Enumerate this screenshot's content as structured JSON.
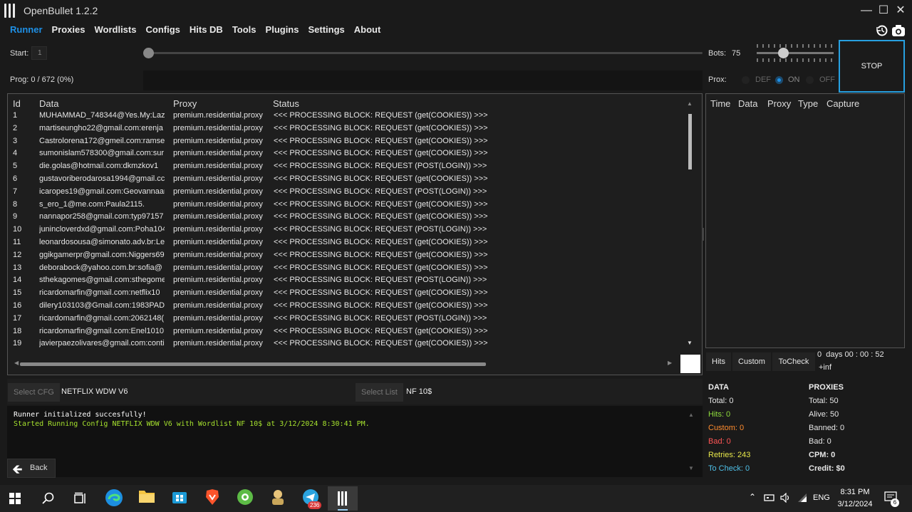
{
  "window": {
    "title": "OpenBullet 1.2.2"
  },
  "menu": [
    "Runner",
    "Proxies",
    "Wordlists",
    "Configs",
    "Hits DB",
    "Tools",
    "Plugins",
    "Settings",
    "About"
  ],
  "controls": {
    "start_label": "Start:",
    "start_value": "1",
    "prog_label": "Prog: 0 / 672 (0%)",
    "progress_fraction": 0,
    "bots_label": "Bots:",
    "bots_value": "75",
    "stop_label": "STOP",
    "prox_label": "Prox:",
    "prox_options": [
      "DEF",
      "ON",
      "OFF"
    ],
    "prox_selected": "ON"
  },
  "grid": {
    "columns": [
      "Id",
      "Data",
      "Proxy",
      "Status"
    ],
    "rows": [
      [
        "1",
        "MUHAMMAD_748344@Yes.My:Lazi",
        "premium.residential.proxy",
        "<<< PROCESSING BLOCK: REQUEST (get(COOKIES)) >>>"
      ],
      [
        "2",
        "martiseungho22@gmail.com:erenja",
        "premium.residential.proxy",
        "<<< PROCESSING BLOCK: REQUEST (get(COOKIES)) >>>"
      ],
      [
        "3",
        "Castrolorena172@gmeil.com:ramse",
        "premium.residential.proxy",
        "<<< PROCESSING BLOCK: REQUEST (get(COOKIES)) >>>"
      ],
      [
        "4",
        "sumonislam578300@gmail.com:sur",
        "premium.residential.proxy",
        "<<< PROCESSING BLOCK: REQUEST (get(COOKIES)) >>>"
      ],
      [
        "5",
        "die.golas@hotmail.com:dkmzkov1",
        "premium.residential.proxy",
        "<<< PROCESSING BLOCK: REQUEST (POST(LOGIN)) >>>"
      ],
      [
        "6",
        "gustavoriberodarosa1994@gmail.cc",
        "premium.residential.proxy",
        "<<< PROCESSING BLOCK: REQUEST (get(COOKIES)) >>>"
      ],
      [
        "7",
        "icaropes19@gmail.com:Geovannaar",
        "premium.residential.proxy",
        "<<< PROCESSING BLOCK: REQUEST (POST(LOGIN)) >>>"
      ],
      [
        "8",
        "s_ero_1@me.com:Paula2115.",
        "premium.residential.proxy",
        "<<< PROCESSING BLOCK: REQUEST (get(COOKIES)) >>>"
      ],
      [
        "9",
        "nannapor258@gmail.com:typ97157",
        "premium.residential.proxy",
        "<<< PROCESSING BLOCK: REQUEST (get(COOKIES)) >>>"
      ],
      [
        "10",
        "junincloverdxd@gmail.com:Poha104",
        "premium.residential.proxy",
        "<<< PROCESSING BLOCK: REQUEST (POST(LOGIN)) >>>"
      ],
      [
        "11",
        "leonardosousa@simonato.adv.br:Le",
        "premium.residential.proxy",
        "<<< PROCESSING BLOCK: REQUEST (get(COOKIES)) >>>"
      ],
      [
        "12",
        "ggikgamerpr@gmail.com:Niggers69",
        "premium.residential.proxy",
        "<<< PROCESSING BLOCK: REQUEST (get(COOKIES)) >>>"
      ],
      [
        "13",
        "deborabock@yahoo.com.br:sofia@",
        "premium.residential.proxy",
        "<<< PROCESSING BLOCK: REQUEST (get(COOKIES)) >>>"
      ],
      [
        "14",
        "sthekagomes@gmail.com:sthegome",
        "premium.residential.proxy",
        "<<< PROCESSING BLOCK: REQUEST (POST(LOGIN)) >>>"
      ],
      [
        "15",
        "ricardomarfin@gmail.com:netflix10",
        "premium.residential.proxy",
        "<<< PROCESSING BLOCK: REQUEST (get(COOKIES)) >>>"
      ],
      [
        "16",
        "dilery103103@Gmail.com:1983PADI",
        "premium.residential.proxy",
        "<<< PROCESSING BLOCK: REQUEST (get(COOKIES)) >>>"
      ],
      [
        "17",
        "ricardomarfin@gmail.com:2062148(",
        "premium.residential.proxy",
        "<<< PROCESSING BLOCK: REQUEST (POST(LOGIN)) >>>"
      ],
      [
        "18",
        "ricardomarfin@gmail.com:Enel1010",
        "premium.residential.proxy",
        "<<< PROCESSING BLOCK: REQUEST (get(COOKIES)) >>>"
      ],
      [
        "19",
        "javierpaezolivares@gmail.com:conti",
        "premium.residential.proxy",
        "<<< PROCESSING BLOCK: REQUEST (get(COOKIES)) >>>"
      ]
    ]
  },
  "hits": {
    "columns": [
      "Time",
      "Data",
      "Proxy",
      "Type",
      "Capture"
    ],
    "tabs": [
      "Hits",
      "Custom",
      "ToCheck"
    ],
    "timer": "0  days 00 : 00 : 52",
    "rate": "+inf"
  },
  "select": {
    "cfg_label": "Select CFG",
    "cfg_value": "NETFLIX WDW V6",
    "list_label": "Select List",
    "list_value": "NF 10$"
  },
  "log": {
    "line1": "Runner initialized succesfully!",
    "line2": "Started Running Config NETFLIX WDW V6 with Wordlist NF 10$ at 3/12/2024 8:30:41 PM."
  },
  "back_label": "Back",
  "stats": {
    "data_title": "DATA",
    "data": [
      "Total:  0",
      "Hits:  0",
      "Custom:  0",
      "Bad:  0",
      "Retries:  243",
      "To Check:  0"
    ],
    "data_colors": [
      "#e6e6e6",
      "#8fdc3c",
      "#ff8c2e",
      "#ff5555",
      "#e8e84a",
      "#4fc1e9"
    ],
    "proxies_title": "PROXIES",
    "proxies": [
      "Total:  50",
      "Alive:  50",
      "Banned:  0",
      "Bad:  0",
      "CPM:  0",
      "Credit:  $0"
    ]
  },
  "taskbar": {
    "lang": "ENG",
    "time": "8:31 PM",
    "date": "3/12/2024",
    "notif_count": "6",
    "telegram_badge": "236"
  }
}
